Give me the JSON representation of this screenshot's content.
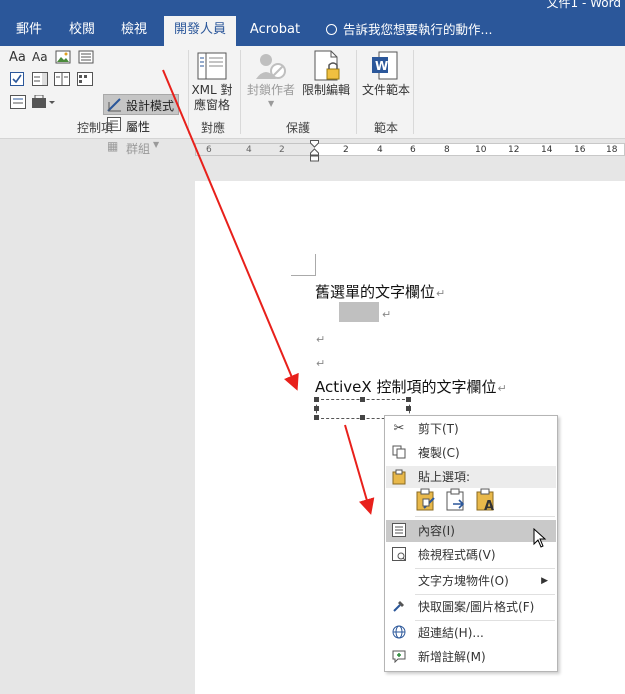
{
  "window": {
    "title": "文件1 - Word"
  },
  "tabs": [
    "郵件",
    "校閱",
    "檢視",
    "開發人員",
    "Acrobat"
  ],
  "tell_me": "告訴我您想要執行的動作...",
  "ribbon": {
    "controls": {
      "design_mode": "設計模式",
      "properties": "屬性",
      "group_btn": "群組",
      "label": "控制項"
    },
    "mapping": {
      "xml_pane_line1": "XML 對",
      "xml_pane_line2": "應窗格",
      "label": "對應"
    },
    "protect": {
      "block_authors_line1": "封鎖作者",
      "restrict_editing": "限制編輯",
      "label": "保護"
    },
    "templates": {
      "doc_template": "文件範本",
      "label": "範本"
    }
  },
  "ruler": {
    "ticks": [
      "6",
      "4",
      "2",
      "2",
      "4",
      "6",
      "8",
      "10",
      "12",
      "14",
      "16",
      "18"
    ]
  },
  "document": {
    "legacy_heading": "舊選單的文字欄位",
    "activex_heading": "ActiveX 控制項的文字欄位"
  },
  "context_menu": {
    "cut": "剪下(T)",
    "copy": "複製(C)",
    "paste_options": "貼上選項:",
    "properties": "內容(I)",
    "view_code": "檢視程式碼(V)",
    "text_box_object": "文字方塊物件(O)",
    "quick_styles": "快取圖案/圖片格式(F)",
    "hyperlink": "超連結(H)...",
    "new_comment": "新增註解(M)"
  },
  "colors": {
    "accent": "#2b579a",
    "arrow": "#e8201b"
  }
}
